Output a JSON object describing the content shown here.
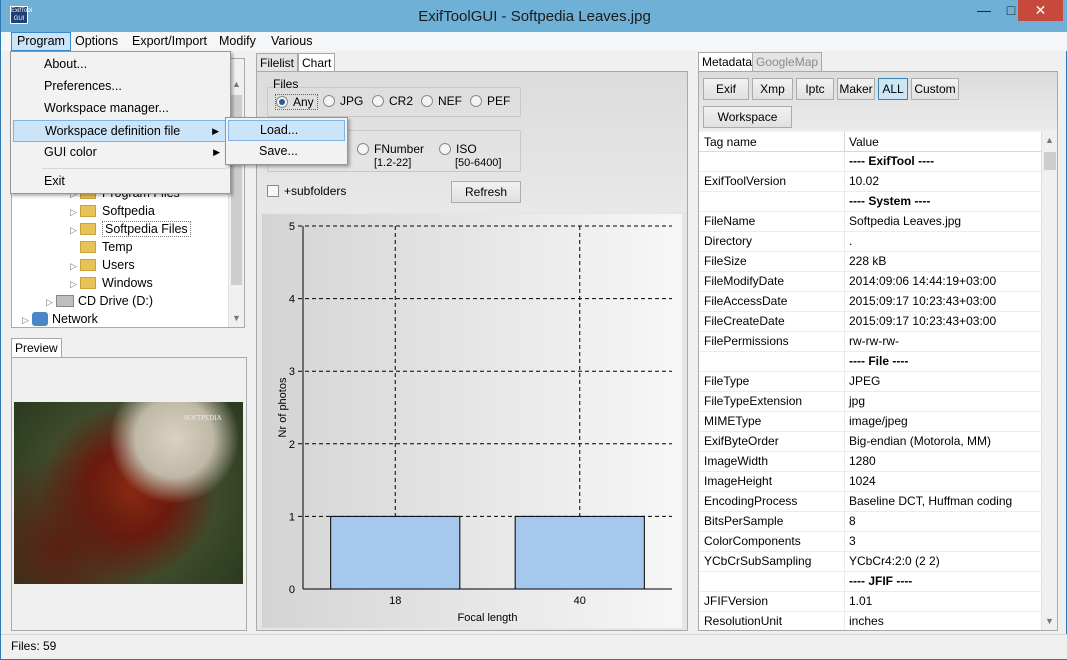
{
  "window": {
    "title": "ExifToolGUI - Softpedia Leaves.jpg",
    "icon_text": "ExifTool GUI"
  },
  "menubar": [
    "Program",
    "Options",
    "Export/Import",
    "Modify",
    "Various"
  ],
  "program_menu": {
    "items": [
      "About...",
      "Preferences...",
      "Workspace manager...",
      "Workspace definition file",
      "GUI color",
      "Exit"
    ],
    "submenu": [
      "Load...",
      "Save..."
    ]
  },
  "tree": {
    "nodes": [
      {
        "label": "Program Files",
        "type": "folder"
      },
      {
        "label": "Softpedia",
        "type": "folder"
      },
      {
        "label": "Softpedia Files",
        "type": "folder"
      },
      {
        "label": "Temp",
        "type": "folder"
      },
      {
        "label": "Users",
        "type": "folder"
      },
      {
        "label": "Windows",
        "type": "folder"
      },
      {
        "label": "CD Drive (D:)",
        "type": "drive"
      },
      {
        "label": "Network",
        "type": "network"
      }
    ]
  },
  "preview": {
    "tab": "Preview",
    "watermark": "SOFTPEDIA"
  },
  "center": {
    "tabs": [
      "Filelist",
      "Chart"
    ],
    "files_label": "Files",
    "file_types": [
      "Any",
      "JPG",
      "CR2",
      "NEF",
      "PEF"
    ],
    "chart_options": [
      {
        "label": "FNumber",
        "sub": "[1.2-22]"
      },
      {
        "label": "ISO",
        "sub": "[50-6400]"
      }
    ],
    "subfolders_label": "+subfolders",
    "refresh_label": "Refresh"
  },
  "chart_data": {
    "type": "bar",
    "categories": [
      "18",
      "40"
    ],
    "values": [
      1,
      1
    ],
    "xlabel": "Focal length",
    "ylabel": "Nr of photos",
    "ylim": [
      0,
      5
    ],
    "yticks": [
      "0",
      "1",
      "2",
      "3",
      "4",
      "5"
    ],
    "bar_color": "#a6c8ef",
    "grid": true
  },
  "metadata": {
    "tabs": [
      "Metadata",
      "GoogleMap"
    ],
    "buttons": [
      "Exif",
      "Xmp",
      "Iptc",
      "Maker",
      "ALL",
      "Custom"
    ],
    "workspace_label": "Workspace",
    "columns": [
      "Tag name",
      "Value"
    ],
    "rows": [
      {
        "tag": "",
        "value": "---- ExifTool ----",
        "header": true
      },
      {
        "tag": "ExifToolVersion",
        "value": "10.02"
      },
      {
        "tag": "",
        "value": "---- System ----",
        "header": true
      },
      {
        "tag": "FileName",
        "value": "Softpedia Leaves.jpg"
      },
      {
        "tag": "Directory",
        "value": "."
      },
      {
        "tag": "FileSize",
        "value": "228 kB"
      },
      {
        "tag": "FileModifyDate",
        "value": "2014:09:06 14:44:19+03:00"
      },
      {
        "tag": "FileAccessDate",
        "value": "2015:09:17 10:23:43+03:00"
      },
      {
        "tag": "FileCreateDate",
        "value": "2015:09:17 10:23:43+03:00"
      },
      {
        "tag": "FilePermissions",
        "value": "rw-rw-rw-"
      },
      {
        "tag": "",
        "value": "---- File ----",
        "header": true
      },
      {
        "tag": "FileType",
        "value": "JPEG"
      },
      {
        "tag": "FileTypeExtension",
        "value": "jpg"
      },
      {
        "tag": "MIMEType",
        "value": "image/jpeg"
      },
      {
        "tag": "ExifByteOrder",
        "value": "Big-endian (Motorola, MM)"
      },
      {
        "tag": "ImageWidth",
        "value": "1280"
      },
      {
        "tag": "ImageHeight",
        "value": "1024"
      },
      {
        "tag": "EncodingProcess",
        "value": "Baseline DCT, Huffman coding"
      },
      {
        "tag": "BitsPerSample",
        "value": "8"
      },
      {
        "tag": "ColorComponents",
        "value": "3"
      },
      {
        "tag": "YCbCrSubSampling",
        "value": "YCbCr4:2:0 (2 2)"
      },
      {
        "tag": "",
        "value": "---- JFIF ----",
        "header": true
      },
      {
        "tag": "JFIFVersion",
        "value": "1.01"
      },
      {
        "tag": "ResolutionUnit",
        "value": "inches"
      }
    ]
  },
  "status": "Files: 59"
}
